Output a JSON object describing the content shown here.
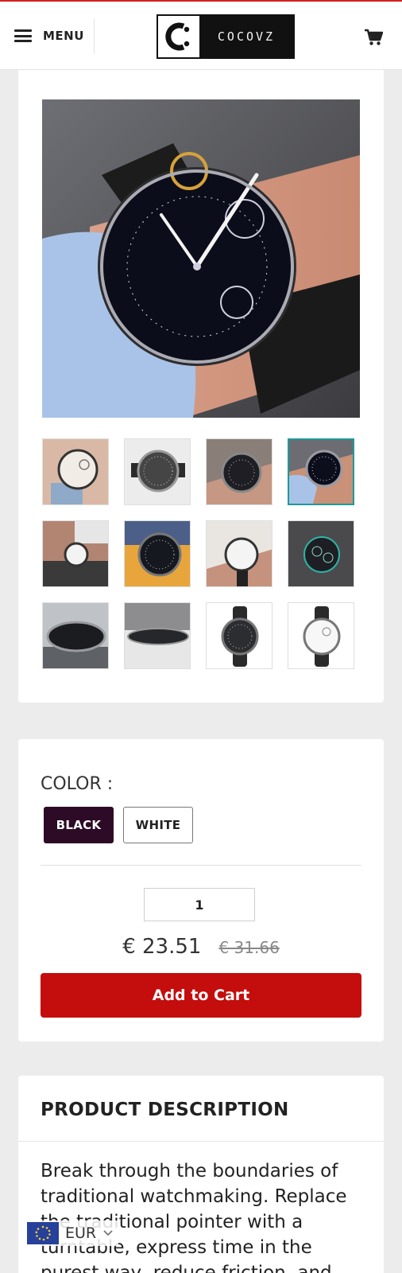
{
  "header": {
    "menu_label": "MENU",
    "logo_text": "COCOVZ",
    "cart_icon": "cart-icon"
  },
  "gallery": {
    "main_image": "watch-on-wrist-photo",
    "thumbnails_count": 12,
    "active_thumbnail": 4
  },
  "options": {
    "color_label": "COLOR :",
    "colors": [
      "BLACK",
      "WHITE"
    ],
    "selected_color": "BLACK",
    "quantity": "1",
    "price": "€ 23.51",
    "old_price": "€ 31.66",
    "add_to_cart_label": "Add to Cart"
  },
  "description": {
    "title": "PRODUCT DESCRIPTION",
    "text": "Break through the boundaries of traditional watchmaking. Replace the traditional pointer with a turntable, express time in the purest way, reduce friction, and"
  },
  "currency": {
    "code": "EUR"
  },
  "colors": {
    "brand_red": "#c40d0d",
    "selected_swatch": "#2d0b26",
    "thumbnail_active": "#1d9a9a"
  }
}
